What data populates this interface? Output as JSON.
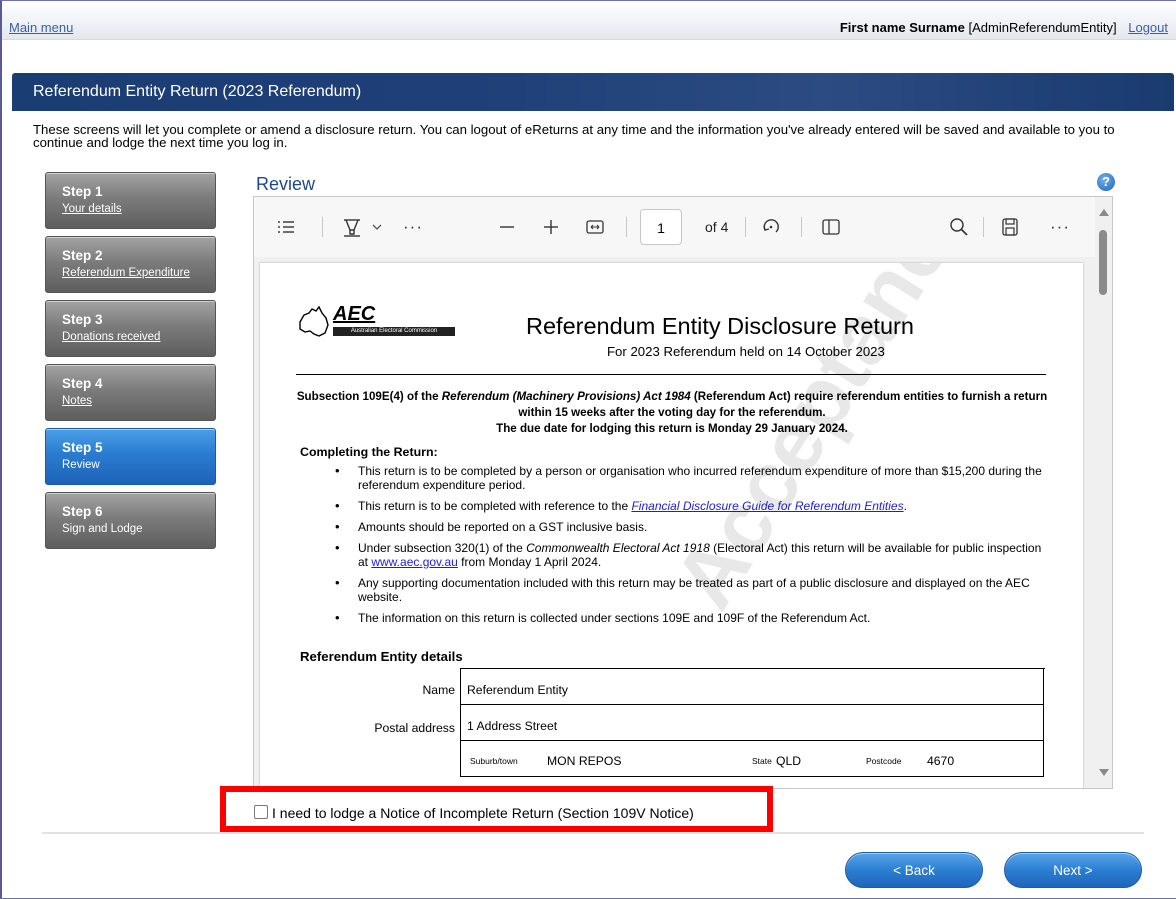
{
  "topbar": {
    "main_menu": "Main menu",
    "user_name": "First name Surname",
    "user_role": "[AdminReferendumEntity]",
    "logout": "Logout"
  },
  "banner": {
    "title": "Referendum Entity Return (2023 Referendum)"
  },
  "intro": "These screens will let you complete or amend a disclosure return. You can logout of eReturns at any time and the information you've already entered will be saved and available to you to continue and lodge the next time you log in.",
  "steps": [
    {
      "title": "Step 1",
      "label": "Your details",
      "active": false
    },
    {
      "title": "Step 2",
      "label": "Referendum Expenditure",
      "active": false
    },
    {
      "title": "Step 3",
      "label": "Donations received",
      "active": false
    },
    {
      "title": "Step 4",
      "label": "Notes",
      "active": false
    },
    {
      "title": "Step 5",
      "label": "Review",
      "active": true
    },
    {
      "title": "Step 6",
      "label": "Sign and Lodge",
      "active": false
    }
  ],
  "review": {
    "title": "Review",
    "help": "?",
    "viewer": {
      "page_number": "1",
      "page_of": "of 4",
      "icons": [
        "contents-icon",
        "draw-icon",
        "chevron-down-icon",
        "more-icon",
        "zoom-out-icon",
        "zoom-in-icon",
        "fit-width-icon",
        "rotate-icon",
        "page-view-icon",
        "search-icon",
        "save-icon",
        "more-icon"
      ]
    },
    "document": {
      "logo_text": "AEC",
      "logo_bar": "Australian Electoral Commission",
      "title": "Referendum Entity Disclosure Return",
      "subtitle": "For 2023 Referendum held on 14 October 2023",
      "sub1_a": "Subsection 109E(4) of the ",
      "sub1_b": "Referendum (Machinery Provisions) Act 1984",
      "sub1_c": " (Referendum Act) require referendum entities to furnish a return within 15 weeks after the voting day for the referendum.",
      "due": "The due date for lodging this return is Monday 29 January 2024.",
      "completing": "Completing the Return:",
      "bullets": [
        "This return is to be completed by a person or organisation who incurred referendum expenditure of more than $15,200 during the referendum expenditure period.",
        "This return is to be completed with reference to the ",
        "Amounts should be reported on a GST inclusive basis.",
        "Under subsection 320(1) of the ",
        "Any supporting documentation included with this return may be treated as part of a public disclosure and displayed on the AEC website.",
        "The information on this return is collected under sections 109E and 109F of the Referendum Act."
      ],
      "bullet2_link": "Financial Disclosure Guide for Referendum Entities",
      "bullet4_italic": "Commonwealth Electoral Act 1918",
      "bullet4_rest": " (Electoral Act) this return will be available for public inspection at ",
      "bullet4_link": "www.aec.gov.au",
      "bullet4_end": " from Monday 1 April 2024.",
      "details_head": "Referendum Entity details",
      "name_label": "Name",
      "name_value": "Referendum Entity",
      "postal_label": "Postal address",
      "postal_value": "1 Address Street",
      "suburb_label": "Suburb/town",
      "suburb_value": "MON REPOS",
      "state_label": "State",
      "state_value": "QLD",
      "postcode_label": "Postcode",
      "postcode_value": "4670",
      "watermark": "Acceptance Test"
    }
  },
  "notice_checkbox": "I need to lodge a Notice of Incomplete Return (Section 109V Notice)",
  "buttons": {
    "back": "< Back",
    "next": "Next >"
  }
}
